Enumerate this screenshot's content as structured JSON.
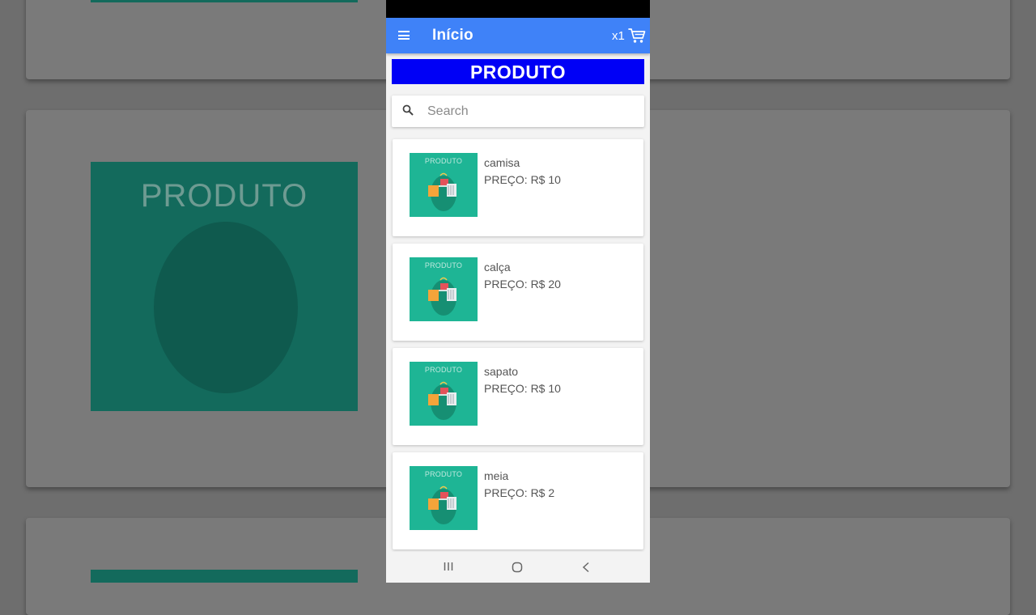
{
  "appbar": {
    "title": "Início",
    "cart_count": "x1",
    "menu_icon": "menu-icon",
    "cart_icon": "cart-icon"
  },
  "banner": {
    "text": "PRODUTO"
  },
  "search": {
    "placeholder": "Search",
    "value": "",
    "icon": "search-icon"
  },
  "products": [
    {
      "name": "camisa",
      "price": "PREÇO: R$ 10",
      "thumb_label": "PRODUTO"
    },
    {
      "name": "calça",
      "price": "PREÇO: R$ 20",
      "thumb_label": "PRODUTO"
    },
    {
      "name": "sapato",
      "price": "PREÇO: R$ 10",
      "thumb_label": "PRODUTO"
    },
    {
      "name": "meia",
      "price": "PREÇO: R$ 2",
      "thumb_label": "PRODUTO"
    }
  ],
  "background": {
    "thumb_label": "PRODUTO"
  },
  "navbar": {
    "recent_icon": "recent-apps-icon",
    "home_icon": "home-icon",
    "back_icon": "back-icon"
  },
  "colors": {
    "appbar": "#3f82f8",
    "banner": "#0000f6",
    "thumb": "#1eb595"
  }
}
